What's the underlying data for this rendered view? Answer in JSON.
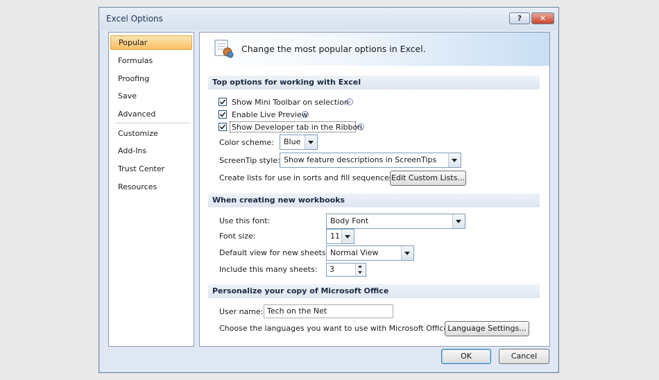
{
  "window": {
    "title": "Excel Options",
    "help_label": "?",
    "close_label": "✕"
  },
  "sidebar": {
    "items": [
      {
        "label": "Popular",
        "active": true
      },
      {
        "label": "Formulas"
      },
      {
        "label": "Proofing"
      },
      {
        "label": "Save"
      },
      {
        "label": "Advanced"
      },
      {
        "label": "Customize"
      },
      {
        "label": "Add-Ins"
      },
      {
        "label": "Trust Center"
      },
      {
        "label": "Resources"
      }
    ]
  },
  "banner": {
    "text": "Change the most popular options in Excel.",
    "icon": "options-icon"
  },
  "sections": {
    "top": {
      "header": "Top options for working with Excel",
      "mini_toolbar": {
        "label": "Show Mini Toolbar on selection",
        "checked": true
      },
      "live_preview": {
        "label": "Enable Live Preview",
        "checked": true
      },
      "developer_tab": {
        "label": "Show Developer tab in the Ribbon",
        "checked": true
      },
      "color_scheme": {
        "label": "Color scheme:",
        "value": "Blue"
      },
      "screentip": {
        "label": "ScreenTip style:",
        "value": "Show feature descriptions in ScreenTips"
      },
      "custom_lists": {
        "label": "Create lists for use in sorts and fill sequences:",
        "button": "Edit Custom Lists..."
      }
    },
    "new_workbooks": {
      "header": "When creating new workbooks",
      "font": {
        "label": "Use this font:",
        "value": "Body Font"
      },
      "font_size": {
        "label": "Font size:",
        "value": "11"
      },
      "default_view": {
        "label": "Default view for new sheets:",
        "value": "Normal View"
      },
      "sheets": {
        "label": "Include this many sheets:",
        "value": "3"
      }
    },
    "personalize": {
      "header": "Personalize your copy of Microsoft Office",
      "user_name": {
        "label": "User name:",
        "value": "Tech on the Net"
      },
      "languages": {
        "label": "Choose the languages you want to use with Microsoft Office:",
        "button": "Language Settings..."
      }
    }
  },
  "footer": {
    "ok": "OK",
    "cancel": "Cancel"
  },
  "colors": {
    "accent": "#f9bf63",
    "frame": "#6d84a5",
    "section_bg": "#dfe6f0"
  }
}
